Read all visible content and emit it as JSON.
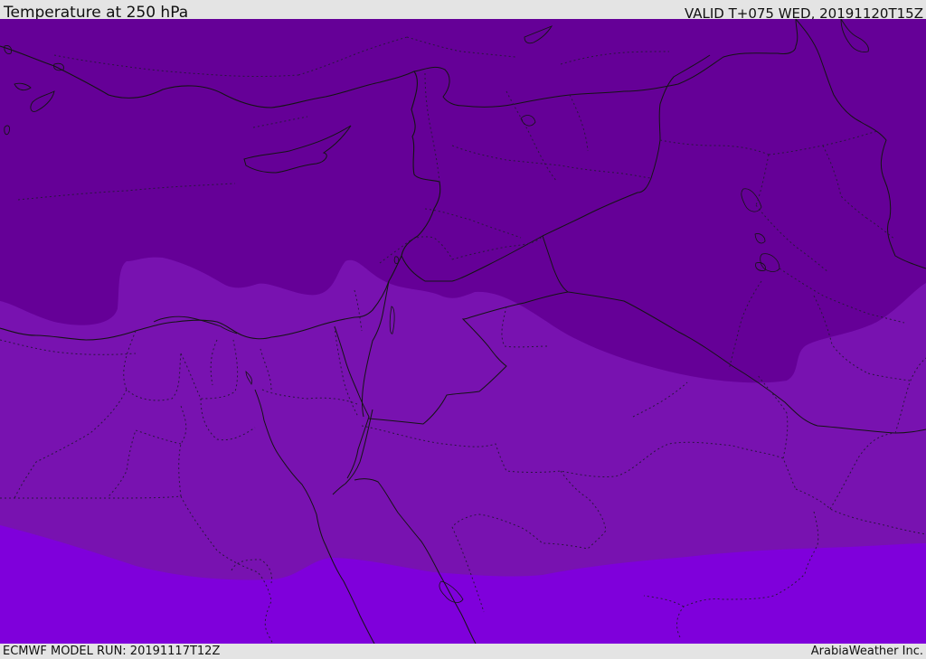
{
  "header": {
    "title": "Temperature at 250 hPa",
    "valid": "VALID T+075 WED, 20191120T15Z"
  },
  "footer": {
    "model_run": "ECMWF MODEL RUN: 20191117T12Z",
    "credit": "ArabiaWeather Inc."
  },
  "map": {
    "region": "Eastern Mediterranean, Levant and Northern Arabia",
    "fill_colors": {
      "coldest_band": "#650097",
      "middle_band": "#7812b0",
      "warmest_band": "#7f00db"
    },
    "line_colors": {
      "coastline": "#141414",
      "boundaries": "#2a1540"
    }
  }
}
